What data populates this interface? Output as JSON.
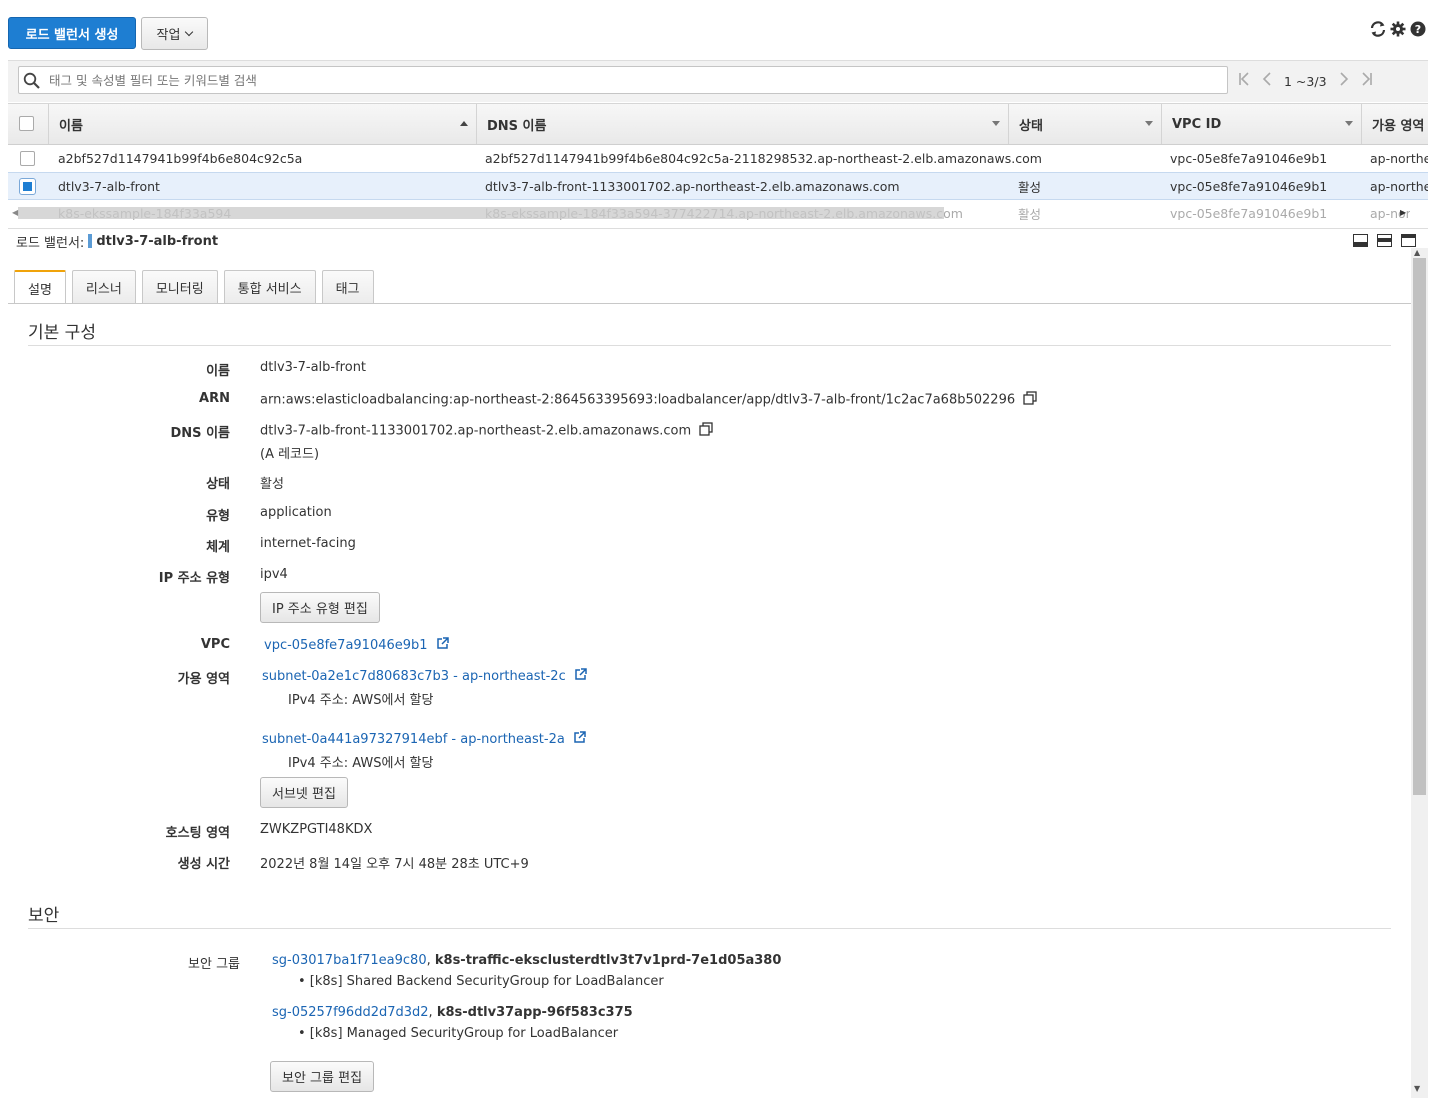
{
  "toolbar": {
    "create_label": "로드 밸런서 생성",
    "actions_label": "작업"
  },
  "search": {
    "placeholder": "태그 및 속성별 필터 또는 키워드별 검색"
  },
  "pager": {
    "count": "1 ~3/3"
  },
  "table": {
    "columns": [
      "이름",
      "DNS 이름",
      "상태",
      "VPC ID",
      "가용 영역"
    ],
    "rows": [
      {
        "name": "a2bf527d1147941b99f4b6e804c92c5a",
        "dns": "a2bf527d1147941b99f4b6e804c92c5a-2118298532.ap-northeast-2.elb.amazonaws.com",
        "state": "",
        "vpc": "vpc-05e8fe7a91046e9b1",
        "az": "ap-northeast",
        "selected": false
      },
      {
        "name": "dtlv3-7-alb-front",
        "dns": "dtlv3-7-alb-front-1133001702.ap-northeast-2.elb.amazonaws.com",
        "state": "활성",
        "vpc": "vpc-05e8fe7a91046e9b1",
        "az": "ap-northeast",
        "selected": true
      },
      {
        "name": "k8s-ekssample-184f33a594",
        "dns": "k8s-ekssample-184f33a594-377422714.ap-northeast-2.elb.amazonaws.com",
        "state": "활성",
        "vpc": "vpc-05e8fe7a91046e9b1",
        "az": "ap-nort",
        "selected": false
      }
    ]
  },
  "detail": {
    "header_label": "로드 밸런서:",
    "header_name": "dtlv3-7-alb-front",
    "tabs": [
      "설명",
      "리스너",
      "모니터링",
      "통합 서비스",
      "태그"
    ],
    "basic": {
      "title": "기본 구성",
      "name_label": "이름",
      "name": "dtlv3-7-alb-front",
      "arn_label": "ARN",
      "arn": "arn:aws:elasticloadbalancing:ap-northeast-2:864563395693:loadbalancer/app/dtlv3-7-alb-front/1c2ac7a68b502296",
      "dns_label": "DNS 이름",
      "dns": "dtlv3-7-alb-front-1133001702.ap-northeast-2.elb.amazonaws.com",
      "dns_note": "(A 레코드)",
      "state_label": "상태",
      "state": "활성",
      "type_label": "유형",
      "type": "application",
      "scheme_label": "체계",
      "scheme": "internet-facing",
      "ip_label": "IP 주소 유형",
      "ip": "ipv4",
      "ip_edit": "IP 주소 유형 편집",
      "vpc_label": "VPC",
      "vpc": "vpc-05e8fe7a91046e9b1",
      "az_label": "가용 영역",
      "subnet1": "subnet-0a2e1c7d80683c7b3 - ap-northeast-2c",
      "subnet1_ip": "IPv4 주소: AWS에서 할당",
      "subnet2": "subnet-0a441a97327914ebf - ap-northeast-2a",
      "subnet2_ip": "IPv4 주소: AWS에서 할당",
      "subnet_edit": "서브넷 편집",
      "zone_label": "호스팅 영역",
      "zone": "ZWKZPGTI48KDX",
      "created_label": "생성 시간",
      "created": "2022년 8월 14일 오후 7시 48분 28초 UTC+9"
    },
    "security": {
      "title": "보안",
      "sg_label": "보안 그룹",
      "sg1_id": "sg-03017ba1f71ea9c80",
      "sg1_name": "k8s-traffic-eksclusterdtlv3t7v1prd-7e1d05a380",
      "sg1_desc": "• [k8s] Shared Backend SecurityGroup for LoadBalancer",
      "sg2_id": "sg-05257f96dd2d7d3d2",
      "sg2_name": "k8s-dtlv37app-96f583c375",
      "sg2_desc": "• [k8s] Managed SecurityGroup for LoadBalancer",
      "sg_edit": "보안 그룹 편집"
    }
  }
}
